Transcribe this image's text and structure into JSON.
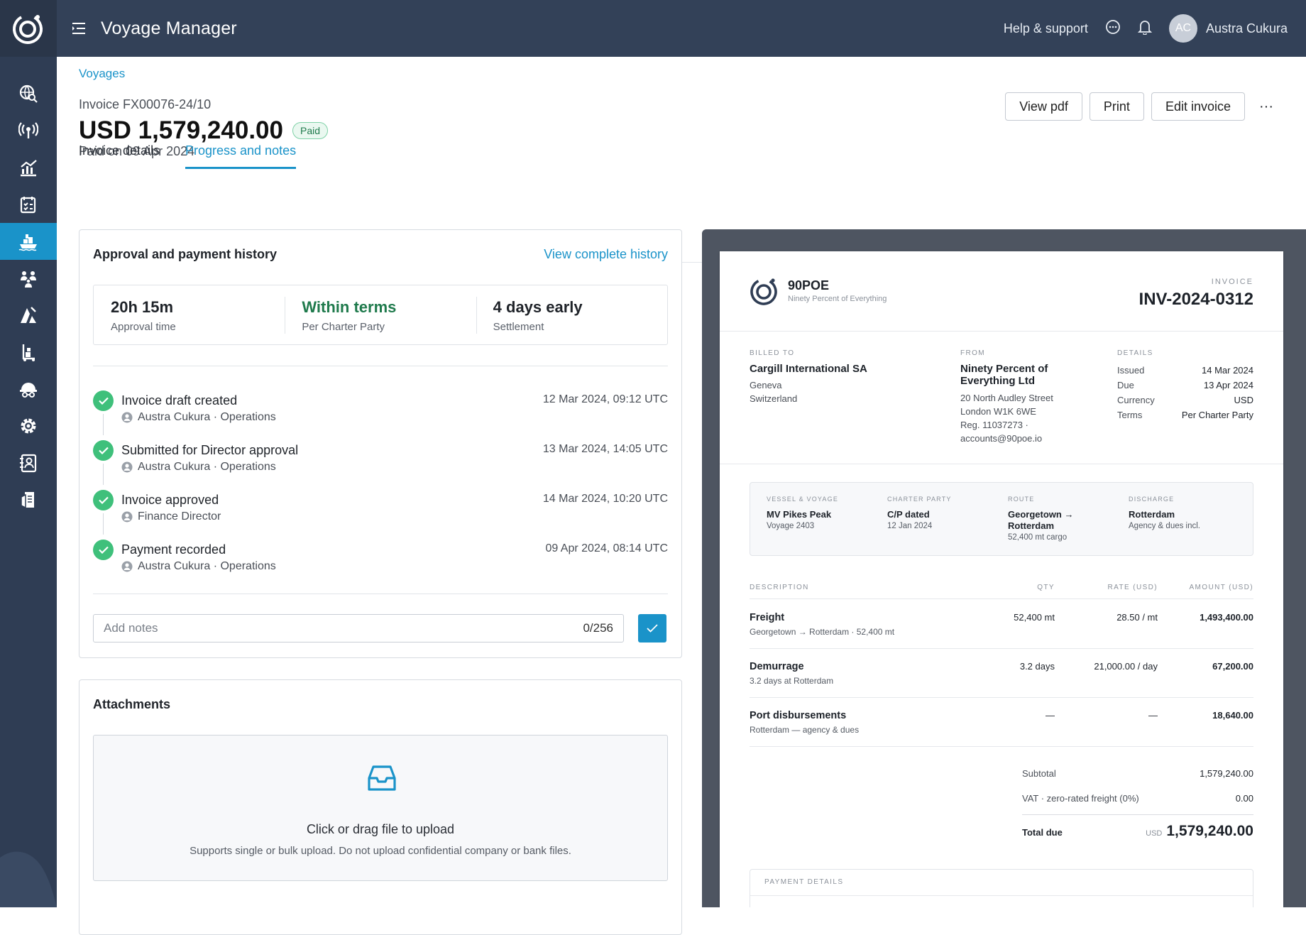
{
  "app": {
    "title": "Voyage Manager"
  },
  "topbar": {
    "help": "Help & support",
    "user_initials": "AC",
    "user_name": "Austra Cukura"
  },
  "breadcrumb": "Voyages",
  "invoice": {
    "number": "Invoice FX00076-24/10",
    "amount": "USD 1,579,240.00",
    "status": "Paid",
    "paid_on": "Paid on 09 Apr 2024"
  },
  "actions": {
    "view_pdf": "View pdf",
    "print": "Print",
    "edit": "Edit invoice",
    "more": "···"
  },
  "tabs": [
    "Invoice details",
    "Progress and notes"
  ],
  "history": {
    "title": "Approval and payment history",
    "link": "View complete history",
    "stats": [
      {
        "value": "20h 15m",
        "label": "Approval time"
      },
      {
        "value": "Within terms",
        "label": "Per Charter Party"
      },
      {
        "value": "4 days early",
        "label": "Settlement"
      }
    ],
    "events": [
      {
        "title": "Invoice draft created",
        "who": "Austra Cukura · Operations",
        "time": "12 Mar 2024, 09:12 UTC"
      },
      {
        "title": "Submitted for Director approval",
        "who": "Austra Cukura · Operations",
        "time": "13 Mar 2024, 14:05 UTC"
      },
      {
        "title": "Invoice approved",
        "who": "Finance Director",
        "time": "14 Mar 2024, 10:20 UTC"
      },
      {
        "title": "Payment recorded",
        "who": "Austra Cukura · Operations",
        "time": "09 Apr 2024, 08:14 UTC"
      }
    ],
    "notes_placeholder": "Add notes",
    "notes_count": "0/256"
  },
  "attachments": {
    "title": "Attachments",
    "drop_title": "Click or drag file to upload",
    "drop_sub": "Supports single or bulk upload. Do not upload confidential company or bank files."
  },
  "pdf": {
    "brand": "90POE",
    "brand_sub": "Ninety Percent of Everything",
    "invoice_label": "INVOICE",
    "invoice_no": "INV-2024-0312",
    "billed_to": {
      "label": "BILLED TO",
      "name": "Cargill International SA",
      "lines": [
        "Geneva",
        "Switzerland"
      ]
    },
    "from": {
      "label": "FROM",
      "name_1": "Ninety Percent of",
      "name_2": "Everything Ltd",
      "lines": [
        "20 North Audley Street",
        "London W1K 6WE",
        "Reg. 11037273 ·",
        "accounts@90poe.io"
      ]
    },
    "details": {
      "label": "DETAILS",
      "rows": [
        {
          "k": "Issued",
          "v": "14 Mar 2024"
        },
        {
          "k": "Due",
          "v": "13 Apr 2024"
        },
        {
          "k": "Currency",
          "v": "USD"
        },
        {
          "k": "Terms",
          "v": "Per Charter Party"
        }
      ]
    },
    "voyage_box": [
      {
        "label": "VESSEL & VOYAGE",
        "v1": "MV Pikes Peak",
        "v2": "",
        "s1": "Voyage 2403",
        "s2": ""
      },
      {
        "label": "CHARTER PARTY",
        "v1": "C/P dated",
        "v2": "",
        "s1": "12 Jan 2024",
        "s2": ""
      },
      {
        "label": "ROUTE",
        "v1": "Georgetown →",
        "v2": "Rotterdam",
        "s1": "52,400 mt cargo",
        "s2": ""
      },
      {
        "label": "DISCHARGE",
        "v1": "Rotterdam",
        "v2": "",
        "s1": "Agency & dues incl.",
        "s2": ""
      }
    ],
    "columns": {
      "desc": "DESCRIPTION",
      "qty": "QTY",
      "rate": "RATE (USD)",
      "amount": "AMOUNT (USD)"
    },
    "lines": [
      {
        "desc": "Freight",
        "sub": "Georgetown → Rotterdam · 52,400 mt",
        "qty": "52,400 mt",
        "rate": "28.50 / mt",
        "amount": "1,493,400.00"
      },
      {
        "desc": "Demurrage",
        "sub": "3.2 days at Rotterdam",
        "qty": "3.2 days",
        "rate": "21,000.00 / day",
        "amount": "67,200.00"
      },
      {
        "desc": "Port disbursements",
        "sub": "Rotterdam — agency & dues",
        "qty": "—",
        "rate": "—",
        "amount": "18,640.00"
      }
    ],
    "subtotal": {
      "k": "Subtotal",
      "v": "1,579,240.00"
    },
    "vat": {
      "k": "VAT · zero-rated freight (0%)",
      "v": "0.00"
    },
    "total": {
      "k": "Total due",
      "cur": "USD",
      "v": "1,579,240.00"
    },
    "payment_label": "PAYMENT DETAILS"
  },
  "colors": {
    "accent": "#1a93c9",
    "sidebar": "#2f3d54",
    "topbar": "#334158",
    "success": "#3fc07b",
    "within_terms": "#1f7a4c"
  }
}
